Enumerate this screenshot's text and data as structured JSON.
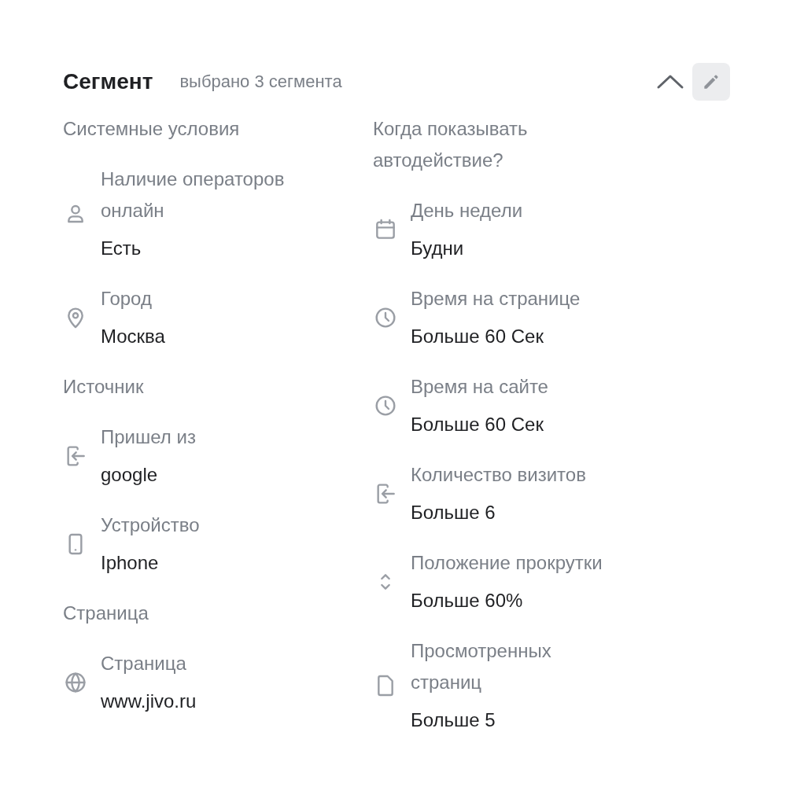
{
  "header": {
    "title": "Сегмент",
    "subtitle": "выбрано 3 сегмента",
    "expanded": true
  },
  "columns": [
    {
      "entries": [
        {
          "kind": "heading",
          "text": "Системные условия"
        },
        {
          "kind": "item",
          "label": "Наличие операторов онлайн",
          "value": "Есть"
        },
        {
          "kind": "item",
          "label": "Город",
          "value": "Москва"
        },
        {
          "kind": "heading",
          "text": "Источник"
        },
        {
          "kind": "item",
          "label": "Пришел из",
          "value": "google"
        },
        {
          "kind": "item",
          "label": "Устройство",
          "value": "Iphone"
        },
        {
          "kind": "heading",
          "text": "Страница"
        },
        {
          "kind": "item",
          "label": "Страница",
          "value": "www.jivo.ru"
        }
      ]
    },
    {
      "entries": [
        {
          "kind": "heading",
          "text": "Когда показывать автодействие?"
        },
        {
          "kind": "item",
          "label": "День недели",
          "value": "Будни"
        },
        {
          "kind": "item",
          "label": "Время на странице",
          "value": "Больше 60 Сек"
        },
        {
          "kind": "item",
          "label": "Время на сайте",
          "value": "Больше 60 Сек"
        },
        {
          "kind": "item",
          "label": "Количество визитов",
          "value": "Больше 6"
        },
        {
          "kind": "item",
          "label": "Положение прокрутки",
          "value": "Больше 60%"
        },
        {
          "kind": "item",
          "label": "Просмотренных страниц",
          "value": "Больше 5"
        }
      ]
    }
  ]
}
